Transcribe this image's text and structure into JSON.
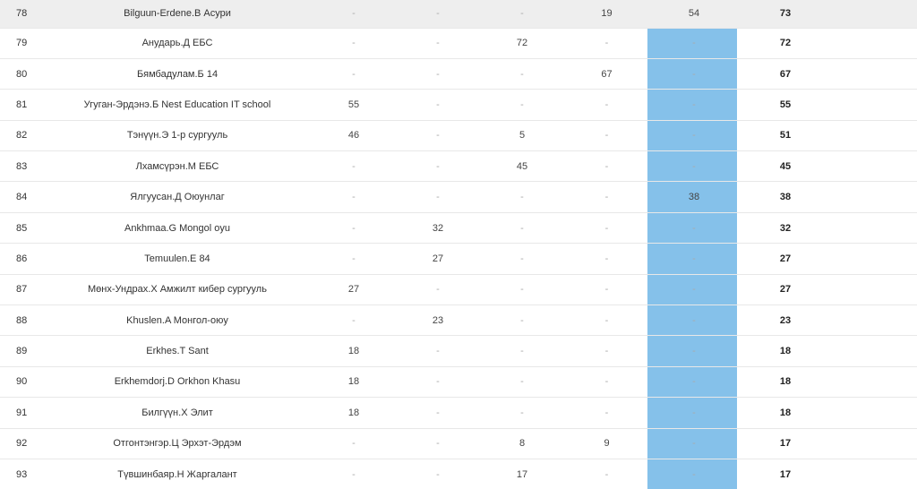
{
  "colors": {
    "highlight_column": "#85c1ea",
    "first_row_bg": "#eeeeee",
    "dash": "#aaaaaa"
  },
  "rows": [
    {
      "rank": "78",
      "name": "Bilguun-Erdene.B Асури",
      "s1": "-",
      "s2": "-",
      "s3": "-",
      "s4": "19",
      "s5": "54",
      "total": "73"
    },
    {
      "rank": "79",
      "name": "Анударь.Д ЕБС",
      "s1": "-",
      "s2": "-",
      "s3": "72",
      "s4": "-",
      "s5": "-",
      "total": "72"
    },
    {
      "rank": "80",
      "name": "Бямбадулам.Б 14",
      "s1": "-",
      "s2": "-",
      "s3": "-",
      "s4": "67",
      "s5": "-",
      "total": "67"
    },
    {
      "rank": "81",
      "name": "Угуган-Эрдэнэ.Б Nest Education IT school",
      "s1": "55",
      "s2": "-",
      "s3": "-",
      "s4": "-",
      "s5": "-",
      "total": "55"
    },
    {
      "rank": "82",
      "name": "Тэнүүн.Э 1-р сургууль",
      "s1": "46",
      "s2": "-",
      "s3": "5",
      "s4": "-",
      "s5": "-",
      "total": "51"
    },
    {
      "rank": "83",
      "name": "Лхамсүрэн.М ЕБС",
      "s1": "-",
      "s2": "-",
      "s3": "45",
      "s4": "-",
      "s5": "-",
      "total": "45"
    },
    {
      "rank": "84",
      "name": "Ялгуусан.Д Оюунлаг",
      "s1": "-",
      "s2": "-",
      "s3": "-",
      "s4": "-",
      "s5": "38",
      "total": "38"
    },
    {
      "rank": "85",
      "name": "Ankhmaa.G Mongol oyu",
      "s1": "-",
      "s2": "32",
      "s3": "-",
      "s4": "-",
      "s5": "-",
      "total": "32"
    },
    {
      "rank": "86",
      "name": "Temuulen.E 84",
      "s1": "-",
      "s2": "27",
      "s3": "-",
      "s4": "-",
      "s5": "-",
      "total": "27"
    },
    {
      "rank": "87",
      "name": "Мөнх-Ундрах.Х Амжилт кибер сургууль",
      "s1": "27",
      "s2": "-",
      "s3": "-",
      "s4": "-",
      "s5": "-",
      "total": "27"
    },
    {
      "rank": "88",
      "name": "Khuslen.A Монгол-оюу",
      "s1": "-",
      "s2": "23",
      "s3": "-",
      "s4": "-",
      "s5": "-",
      "total": "23"
    },
    {
      "rank": "89",
      "name": "Erkhes.T Sant",
      "s1": "18",
      "s2": "-",
      "s3": "-",
      "s4": "-",
      "s5": "-",
      "total": "18"
    },
    {
      "rank": "90",
      "name": "Erkhemdorj.D Orkhon Khasu",
      "s1": "18",
      "s2": "-",
      "s3": "-",
      "s4": "-",
      "s5": "-",
      "total": "18"
    },
    {
      "rank": "91",
      "name": "Билгүүн.Х Элит",
      "s1": "18",
      "s2": "-",
      "s3": "-",
      "s4": "-",
      "s5": "-",
      "total": "18"
    },
    {
      "rank": "92",
      "name": "Отгонтэнгэр.Ц Эрхэт-Эрдэм",
      "s1": "-",
      "s2": "-",
      "s3": "8",
      "s4": "9",
      "s5": "-",
      "total": "17"
    },
    {
      "rank": "93",
      "name": "Түвшинбаяр.Н Жаргалант",
      "s1": "-",
      "s2": "-",
      "s3": "17",
      "s4": "-",
      "s5": "-",
      "total": "17"
    }
  ]
}
